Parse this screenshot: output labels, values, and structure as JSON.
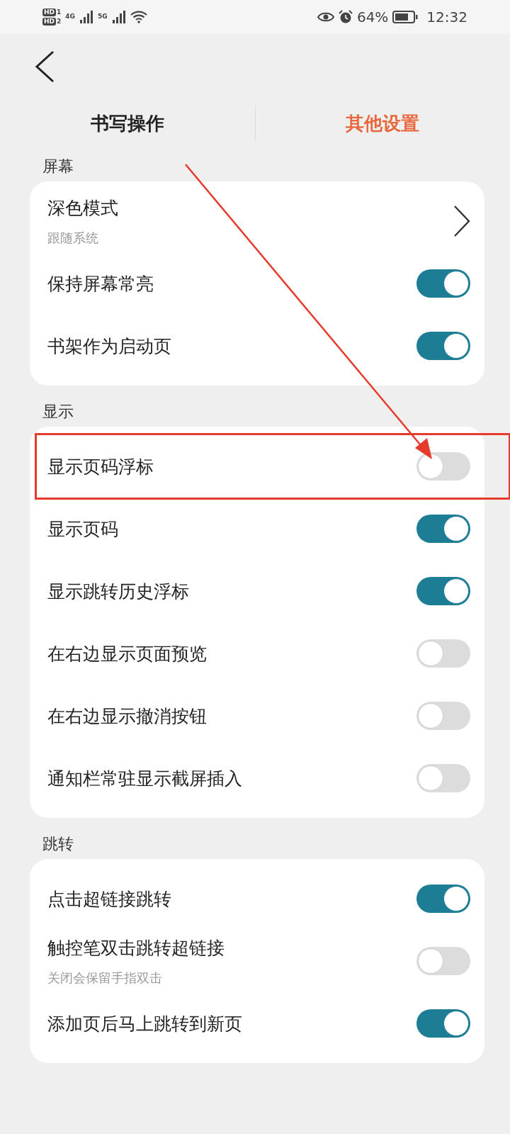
{
  "status_bar": {
    "sims": [
      {
        "badge": "HD",
        "slot": "1"
      },
      {
        "badge": "HD",
        "slot": "2"
      }
    ],
    "networks": [
      "4G",
      "5G"
    ],
    "battery": "64%",
    "time": "12:32"
  },
  "tabs": [
    {
      "label": "书写操作",
      "selected": false
    },
    {
      "label": "其他设置",
      "selected": true
    }
  ],
  "sections": [
    {
      "title": "屏幕",
      "rows": [
        {
          "kind": "link",
          "label": "深色模式",
          "subtitle": "跟随系统"
        },
        {
          "kind": "toggle",
          "label": "保持屏幕常亮",
          "on": true
        },
        {
          "kind": "toggle",
          "label": "书架作为启动页",
          "on": true
        }
      ]
    },
    {
      "title": "显示",
      "rows": [
        {
          "kind": "toggle",
          "label": "显示页码浮标",
          "on": false,
          "highlighted": true
        },
        {
          "kind": "toggle",
          "label": "显示页码",
          "on": true
        },
        {
          "kind": "toggle",
          "label": "显示跳转历史浮标",
          "on": true
        },
        {
          "kind": "toggle",
          "label": "在右边显示页面预览",
          "on": false
        },
        {
          "kind": "toggle",
          "label": "在右边显示撤消按钮",
          "on": false
        },
        {
          "kind": "toggle",
          "label": "通知栏常驻显示截屏插入",
          "on": false
        }
      ]
    },
    {
      "title": "跳转",
      "rows": [
        {
          "kind": "toggle",
          "label": "点击超链接跳转",
          "on": true
        },
        {
          "kind": "toggle",
          "label": "触控笔双击跳转超链接",
          "subtitle": "关闭会保留手指双击",
          "on": false
        },
        {
          "kind": "toggle",
          "label": "添加页后马上跳转到新页",
          "on": true
        }
      ]
    }
  ]
}
